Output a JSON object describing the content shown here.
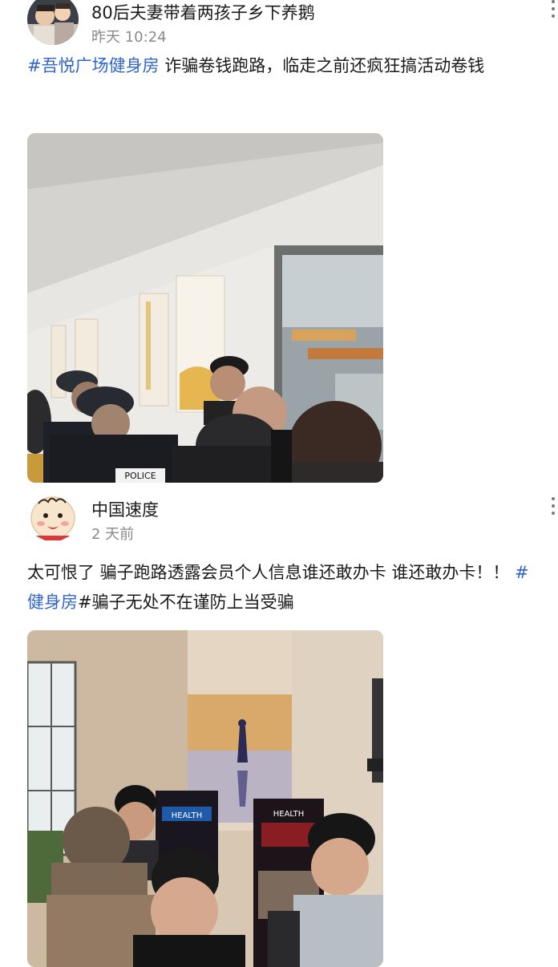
{
  "posts": [
    {
      "author": "80后夫妻带着两孩子乡下养鹅",
      "time": "昨天 10:24",
      "text_parts": [
        "#吾悦广场健身房",
        " 诈骗卷钱跑路，临走之前还疯狂搞活动卷钱"
      ],
      "image_signs": [
        "POLICE"
      ]
    },
    {
      "author": "中国速度",
      "time": "2 天前",
      "text_parts": [
        "太可恨了 骗子跑路透露会员个人信息谁还敢办卡 谁还敢办卡！！ ",
        "#健身房",
        "#骗子无处不在谨防上当受骗"
      ],
      "image_signs": [
        "HEALTH",
        "HEALTH"
      ]
    }
  ],
  "icons": {
    "more": "more-vertical-icon"
  },
  "colors": {
    "hashtag": "#2f64c8",
    "time": "#8a8a8a",
    "text": "#1a1a1a"
  }
}
